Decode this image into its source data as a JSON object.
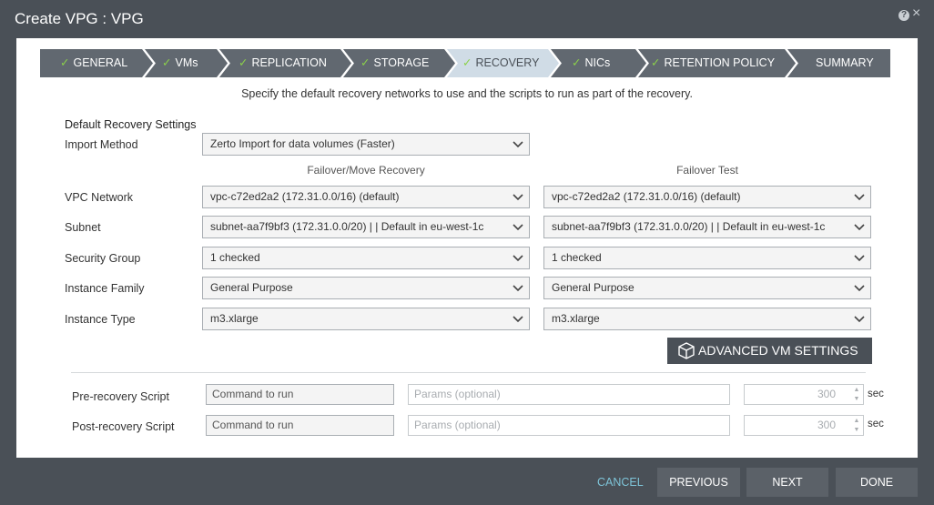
{
  "window": {
    "title": "Create VPG : VPG",
    "help_glyph": "?",
    "close_glyph": "×",
    "help_icon": "help-icon",
    "close_icon": "close-icon"
  },
  "steps": [
    {
      "label": "GENERAL",
      "state": "done"
    },
    {
      "label": "VMs",
      "state": "done"
    },
    {
      "label": "REPLICATION",
      "state": "done"
    },
    {
      "label": "STORAGE",
      "state": "done"
    },
    {
      "label": "RECOVERY",
      "state": "active"
    },
    {
      "label": "NICs",
      "state": "done"
    },
    {
      "label": "RETENTION POLICY",
      "state": "done"
    },
    {
      "label": "SUMMARY",
      "state": "pending"
    }
  ],
  "intro": "Specify the default recovery networks to use and the scripts to run as part of the recovery.",
  "recovery": {
    "section_title": "Default Recovery Settings",
    "import_method": {
      "label": "Import Method",
      "value": "Zerto Import for data volumes (Faster)"
    },
    "columns": {
      "failover": "Failover/Move Recovery",
      "test": "Failover Test"
    },
    "rows": {
      "vpc": {
        "label": "VPC Network",
        "failover": "vpc-c72ed2a2 (172.31.0.0/16) (default)",
        "test": "vpc-c72ed2a2 (172.31.0.0/16) (default)"
      },
      "subnet": {
        "label": "Subnet",
        "failover": "subnet-aa7f9bf3 (172.31.0.0/20) | | Default in eu-west-1c",
        "test": "subnet-aa7f9bf3 (172.31.0.0/20) | | Default in eu-west-1c"
      },
      "security": {
        "label": "Security Group",
        "failover": "1 checked",
        "test": "1 checked"
      },
      "family": {
        "label": "Instance Family",
        "failover": "General Purpose",
        "test": "General Purpose"
      },
      "type": {
        "label": "Instance Type",
        "failover": "m3.xlarge",
        "test": "m3.xlarge"
      }
    },
    "advanced_button": "ADVANCED VM SETTINGS"
  },
  "scripts": {
    "pre": {
      "label": "Pre-recovery Script",
      "command": "Command to run",
      "params_placeholder": "Params (optional)",
      "timeout": "300",
      "unit": "sec"
    },
    "post": {
      "label": "Post-recovery Script",
      "command": "Command to run",
      "params_placeholder": "Params (optional)",
      "timeout": "300",
      "unit": "sec"
    }
  },
  "footer": {
    "cancel": "CANCEL",
    "previous": "PREVIOUS",
    "next": "NEXT",
    "done": "DONE"
  },
  "colors": {
    "step_done": "#616870",
    "step_active": "#d0dce6",
    "check": "#8cd14a",
    "cancel_link": "#7ec4d8"
  }
}
